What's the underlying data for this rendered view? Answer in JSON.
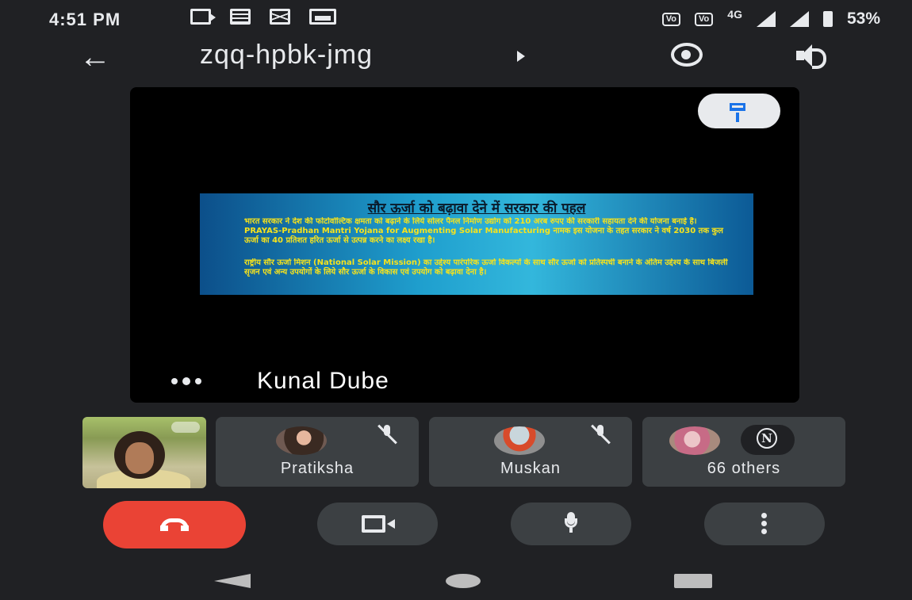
{
  "status_bar": {
    "time": "4:51 PM",
    "network": "4G",
    "battery": "53%",
    "left_icons": [
      "video-call-icon",
      "document-icon",
      "mail-icon",
      "gallery-icon"
    ],
    "right_icons": [
      "volte-icon",
      "volte-icon",
      "signal-icon",
      "signal-icon",
      "battery-icon"
    ]
  },
  "app_bar": {
    "meeting_code": "zqq-hpbk-jmg",
    "icons": [
      "back-arrow-icon",
      "chevron-right-icon",
      "switch-camera-icon",
      "speaker-icon"
    ]
  },
  "main_tile": {
    "speaker_name": "Kunal Dube",
    "pin_icon": "pin-icon",
    "presentation": {
      "title": "सौर ऊर्जा को बढ़ावा देने में सरकार की पहल",
      "paragraph_1": "भारत सरकार ने देश की फोटोवोल्टिक क्षमता को बढ़ाने के लिये सोलर पैनल निर्माण उद्योग को 210 अरब रुपए की सरकारी सहायता देने की योजना बनाई है। PRAYAS-Pradhan Mantri Yojana for Augmenting Solar Manufacturing नामक इस योजना के तहत सरकार ने वर्ष 2030 तक कुल ऊर्जा का 40 प्रतिशत हरित ऊर्जा से उत्पन्न करने का लक्ष्य रखा है।",
      "paragraph_2": "राष्ट्रीय सौर ऊर्जा मिशन (National Solar Mission) का उद्देश्य पारंपरिक ऊर्जा विकल्पों के साथ सौर ऊर्जा को प्रतिस्पर्धी बनाने के अंतिम उद्देश्य के साथ बिजली सृजन एवं अन्य उपयोगों के लिये सौर ऊर्जा के विकास एवं उपयोग को बढ़ावा देना है।"
    }
  },
  "participants": [
    {
      "name": "Pratiksha",
      "muted": true
    },
    {
      "name": "Muskan",
      "muted": true
    },
    {
      "name": "66 others",
      "badge": "N"
    }
  ],
  "controls": {
    "end_call_color": "#ea4335",
    "buttons": [
      "end-call-icon",
      "camera-icon",
      "microphone-icon",
      "more-options-icon"
    ]
  },
  "nav_bar": [
    "nav-back-icon",
    "nav-home-icon",
    "nav-recents-icon"
  ]
}
